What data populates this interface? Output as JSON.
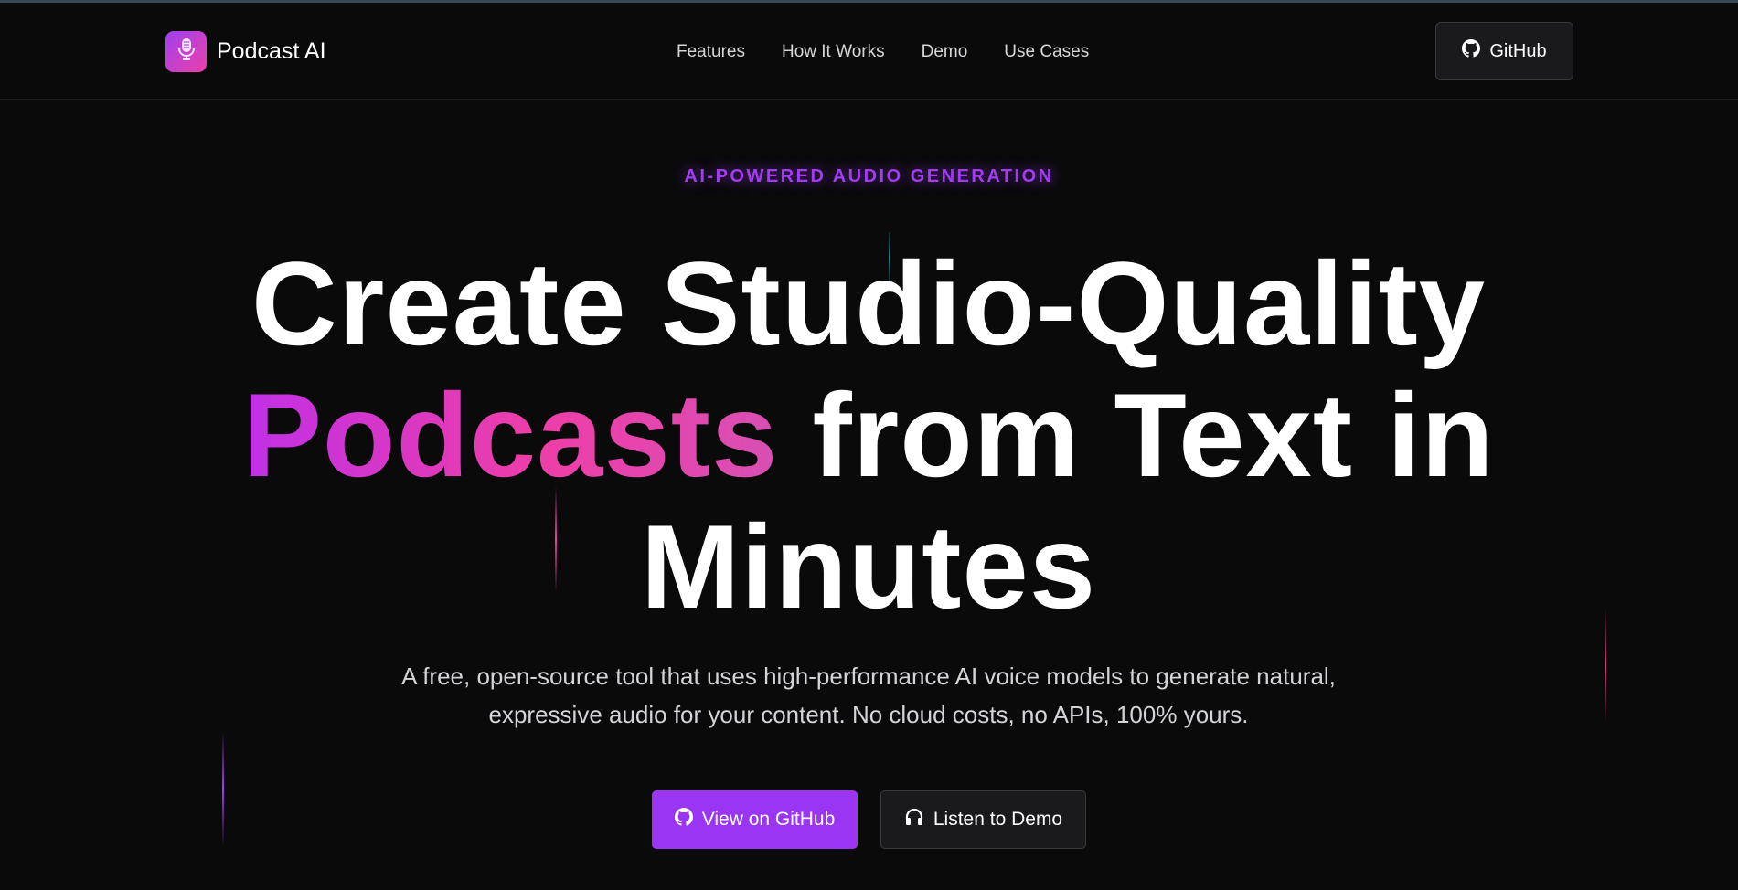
{
  "header": {
    "brand_name": "Podcast AI",
    "nav": [
      {
        "label": "Features"
      },
      {
        "label": "How It Works"
      },
      {
        "label": "Demo"
      },
      {
        "label": "Use Cases"
      }
    ],
    "github_label": "GitHub"
  },
  "hero": {
    "eyebrow": "AI-POWERED AUDIO GENERATION",
    "headline_line1": "Create Studio-Quality",
    "headline_highlight": "Podcasts",
    "headline_line2_rest": " from Text in",
    "headline_line3": "Minutes",
    "subtitle_line1": "A free, open-source tool that uses high-performance AI voice models to generate natural,",
    "subtitle_line2": "expressive audio for your content. No cloud costs, no APIs, 100% yours.",
    "primary_cta": "View on GitHub",
    "secondary_cta": "Listen to Demo"
  },
  "icons": {
    "brand": "microphone-icon",
    "github": "github-icon",
    "demo": "headphones-icon"
  },
  "colors": {
    "background": "#0a0a0b",
    "accent_purple": "#9a36f3",
    "eyebrow": "#a23cf2",
    "gradient_start": "#c030e6",
    "gradient_end": "#ee3ea8",
    "button_dark": "#1a1a1c"
  }
}
